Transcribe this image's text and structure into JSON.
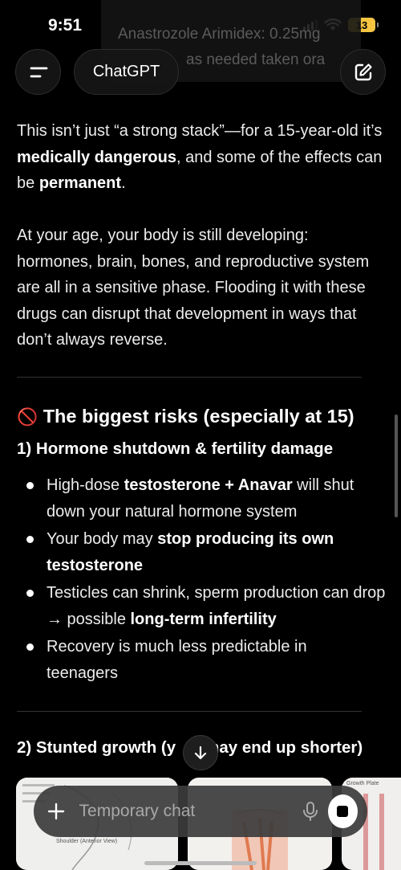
{
  "status_bar": {
    "time": "9:51",
    "battery": "13",
    "battery_color": "#f5c542"
  },
  "background_notification": {
    "line1": "Anastrozole Arimidex: 0.25mg",
    "line2": "as needed taken ora"
  },
  "header": {
    "title": "ChatGPT",
    "menu_icon": "menu-icon",
    "new_chat_icon": "compose-icon"
  },
  "content": {
    "para1": {
      "t1": "This isn’t just “a strong stack”—for a 15-year-old it’s ",
      "b1": "medically dangerous",
      "t2": ", and some of the effects can be ",
      "b2": "permanent",
      "t3": "."
    },
    "para2": "At your age, your body is still developing: hormones, brain, bones, and reproductive system are all in a sensitive phase. Flooding it with these drugs can disrupt that development in ways that don’t always reverse.",
    "section_emoji": "🚫",
    "section_title": "The biggest risks (especially at 15)",
    "subsection1": "1) Hormone shutdown & fertility damage",
    "bullets": [
      {
        "t1": "High-dose ",
        "b": "testosterone + Anavar",
        "t2": " will shut down your natural hormone system"
      },
      {
        "t1": "Your body may ",
        "b": "stop producing its own testosterone",
        "t2": ""
      },
      {
        "t1": "Testicles can shrink, sperm production can drop → possible ",
        "b": "long-term infertility",
        "t2": ""
      },
      {
        "t1": "Recovery is much less predictable in teenagers",
        "b": "",
        "t2": ""
      }
    ],
    "subsection2_pre": "2) Stunted growth (y",
    "subsection2_post": "may end up shorter)"
  },
  "images": {
    "card1_label": "Shoulder (Anterior View)",
    "card3_label": "Growth Plate"
  },
  "composer": {
    "placeholder": "Temporary chat"
  }
}
